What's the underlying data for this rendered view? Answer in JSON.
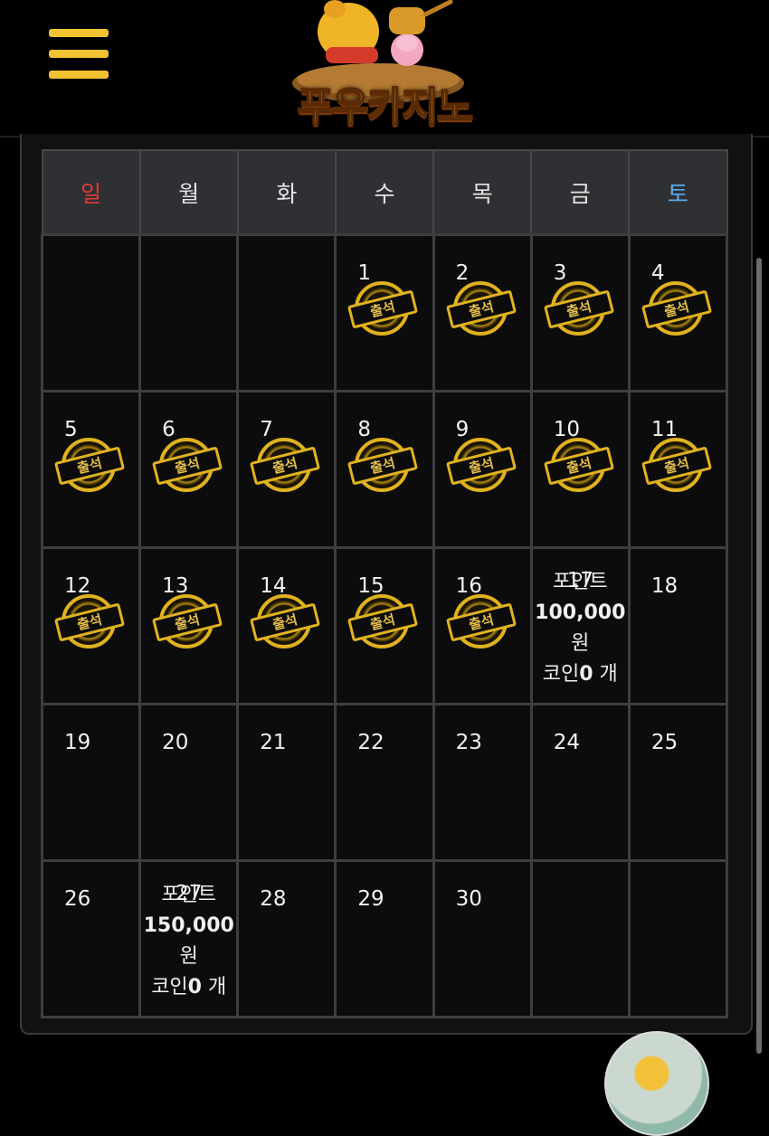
{
  "header": {
    "logo_text": "푸우카지노",
    "menu_icon": "hamburger-menu-icon"
  },
  "calendar": {
    "weekdays": [
      "일",
      "월",
      "화",
      "수",
      "목",
      "금",
      "토"
    ],
    "stamp_label": "출석",
    "weeks": [
      [
        null,
        null,
        null,
        {
          "day": "1",
          "stamp": true
        },
        {
          "day": "2",
          "stamp": true
        },
        {
          "day": "3",
          "stamp": true
        },
        {
          "day": "4",
          "stamp": true
        }
      ],
      [
        {
          "day": "5",
          "stamp": true
        },
        {
          "day": "6",
          "stamp": true
        },
        {
          "day": "7",
          "stamp": true
        },
        {
          "day": "8",
          "stamp": true
        },
        {
          "day": "9",
          "stamp": true
        },
        {
          "day": "10",
          "stamp": true
        },
        {
          "day": "11",
          "stamp": true
        }
      ],
      [
        {
          "day": "12",
          "stamp": true
        },
        {
          "day": "13",
          "stamp": true
        },
        {
          "day": "14",
          "stamp": true
        },
        {
          "day": "15",
          "stamp": true
        },
        {
          "day": "16",
          "stamp": true
        },
        {
          "day": "17",
          "reward": {
            "label": "포인트",
            "amount": "100,000",
            "unit": "원",
            "coin_prefix": "코인",
            "coin_count": "0",
            "coin_suffix": " 개"
          }
        },
        {
          "day": "18"
        }
      ],
      [
        {
          "day": "19"
        },
        {
          "day": "20"
        },
        {
          "day": "21"
        },
        {
          "day": "22"
        },
        {
          "day": "23"
        },
        {
          "day": "24"
        },
        {
          "day": "25"
        }
      ],
      [
        {
          "day": "26"
        },
        {
          "day": "27",
          "reward": {
            "label": "포인트",
            "amount": "150,000",
            "unit": "원",
            "coin_prefix": "코인",
            "coin_count": "0",
            "coin_suffix": " 개"
          }
        },
        {
          "day": "28"
        },
        {
          "day": "29"
        },
        {
          "day": "30"
        },
        null,
        null
      ]
    ]
  },
  "colors": {
    "sunday": "#e23a3a",
    "saturday": "#5aaef0",
    "accent_gold": "#f2c230"
  }
}
